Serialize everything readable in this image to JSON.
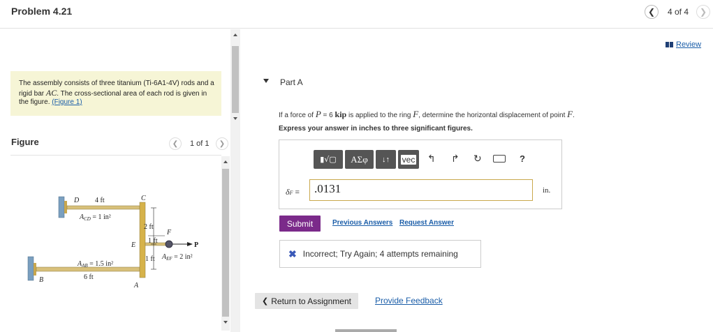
{
  "header": {
    "title": "Problem 4.21",
    "counter": "4 of 4",
    "prev_icon": "chevron-left-icon",
    "next_icon": "chevron-right-icon"
  },
  "review": {
    "label": "Review",
    "icon": "book-icon"
  },
  "description": {
    "text_before": "The assembly consists of three titanium (Ti-6A1-4V) rods and a rigid bar ",
    "bar_name": "AC",
    "text_after": ". The cross-sectional area of each rod is given in the figure. ",
    "link": "(Figure 1)"
  },
  "figure": {
    "label": "Figure",
    "counter": "1 of 1",
    "labels": {
      "D": "D",
      "C": "C",
      "E": "E",
      "F": "F",
      "A": "A",
      "B": "B",
      "P": "P",
      "dim_4ft": "4 ft",
      "dim_2ft": "2 ft",
      "dim_1ft_a": "1 ft",
      "dim_1ft_b": "1 ft",
      "dim_6ft": "6 ft",
      "acd_sym": "A",
      "acd_sub": "CD",
      "acd_val": " = 1 in²",
      "aab_sym": "A",
      "aab_sub": "AB",
      "aab_val": " = 1.5 in²",
      "aef_sym": "A",
      "aef_sub": "EF",
      "aef_val": " = 2 in²"
    }
  },
  "part": {
    "label": "Part A",
    "question": {
      "t1": "If a force of ",
      "sym_p": "P",
      "t2": " = 6 ",
      "unit_kip": "kip",
      "t3": " is applied to the ring ",
      "sym_f": "F",
      "t4": ", determine the horizontal displacement of point ",
      "sym_f2": "F",
      "t5": "."
    },
    "instruction": "Express your answer in inches to three significant figures.",
    "toolbar": {
      "templates": "▮√▢",
      "symbols": "AΣφ",
      "updown": "↓↑",
      "vec": "vec",
      "help": "?"
    },
    "variable": {
      "sym": "δ",
      "sub": "F",
      "eq": " ="
    },
    "answer_value": ".0131",
    "unit": "in.",
    "submit": "Submit",
    "previous_answers": "Previous Answers",
    "request_answer": "Request Answer",
    "feedback": "Incorrect; Try Again; 4 attempts remaining",
    "return_label": "Return to Assignment",
    "provide_feedback": "Provide Feedback"
  },
  "colors": {
    "link": "#1a5da8",
    "submit_bg": "#7b2a8a",
    "desc_bg": "#f6f5d6",
    "incorrect_icon": "#3a59b8"
  }
}
